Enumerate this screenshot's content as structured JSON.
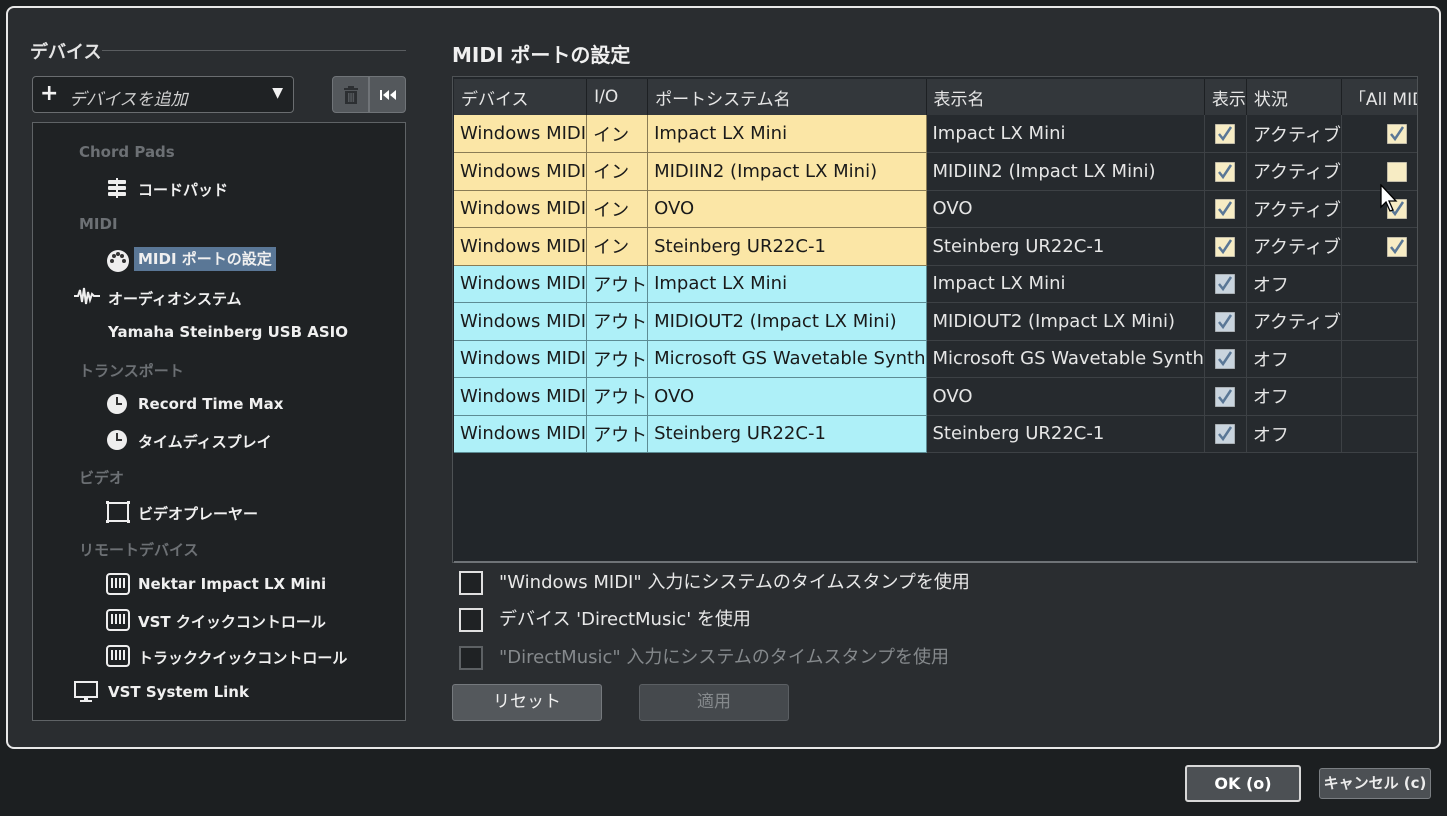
{
  "sidebar": {
    "heading": "デバイス",
    "add_device_label": "デバイスを追加",
    "tree": [
      {
        "type": "category",
        "label": "Chord Pads"
      },
      {
        "type": "device",
        "label": "コードパッド",
        "icon": "sliders-icon"
      },
      {
        "type": "category",
        "label": "MIDI"
      },
      {
        "type": "device",
        "label": "MIDI ポートの設定",
        "icon": "midi-din-icon",
        "selected": true
      },
      {
        "type": "device",
        "label": "オーディオシステム",
        "icon": "waveform-icon"
      },
      {
        "type": "device",
        "label": "Yamaha Steinberg USB ASIO",
        "icon": ""
      },
      {
        "type": "category",
        "label": "トランスポート"
      },
      {
        "type": "device",
        "label": "Record Time Max",
        "icon": "clock-icon"
      },
      {
        "type": "device",
        "label": "タイムディスプレイ",
        "icon": "clock-icon"
      },
      {
        "type": "category",
        "label": "ビデオ"
      },
      {
        "type": "device",
        "label": "ビデオプレーヤー",
        "icon": "film-icon"
      },
      {
        "type": "category",
        "label": "リモートデバイス"
      },
      {
        "type": "device",
        "label": "Nektar Impact LX Mini",
        "icon": "keyboard-icon"
      },
      {
        "type": "device",
        "label": "VST クイックコントロール",
        "icon": "keyboard-icon"
      },
      {
        "type": "device",
        "label": "トラッククイックコントロール",
        "icon": "keyboard-icon"
      },
      {
        "type": "device",
        "label": "VST System Link",
        "icon": "monitor-icon"
      }
    ]
  },
  "main": {
    "title": "MIDI ポートの設定",
    "columns": [
      "デバイス",
      "I/O",
      "ポートシステム名",
      "表示名",
      "表示",
      "状況",
      "「All MIDI In"
    ],
    "rows": [
      {
        "dir": "in",
        "device": "Windows MIDI",
        "io": "イン",
        "port": "Impact LX Mini",
        "display": "Impact LX Mini",
        "show": true,
        "status": "アクティブ",
        "all_midi": true
      },
      {
        "dir": "in",
        "device": "Windows MIDI",
        "io": "イン",
        "port": "MIDIIN2 (Impact LX Mini)",
        "display": "MIDIIN2 (Impact LX Mini)",
        "show": true,
        "status": "アクティブ",
        "all_midi": false
      },
      {
        "dir": "in",
        "device": "Windows MIDI",
        "io": "イン",
        "port": "OVO",
        "display": "OVO",
        "show": true,
        "status": "アクティブ",
        "all_midi": true
      },
      {
        "dir": "in",
        "device": "Windows MIDI",
        "io": "イン",
        "port": "Steinberg UR22C-1",
        "display": "Steinberg UR22C-1",
        "show": true,
        "status": "アクティブ",
        "all_midi": true
      },
      {
        "dir": "out",
        "device": "Windows MIDI",
        "io": "アウト",
        "port": "Impact LX Mini",
        "display": "Impact LX Mini",
        "show": true,
        "status": "オフ",
        "all_midi": null
      },
      {
        "dir": "out",
        "device": "Windows MIDI",
        "io": "アウト",
        "port": "MIDIOUT2 (Impact LX Mini)",
        "display": "MIDIOUT2 (Impact LX Mini)",
        "show": true,
        "status": "アクティブ",
        "all_midi": null
      },
      {
        "dir": "out",
        "device": "Windows MIDI",
        "io": "アウト",
        "port": "Microsoft GS Wavetable Synth",
        "display": "Microsoft GS Wavetable Synth",
        "show": true,
        "status": "オフ",
        "all_midi": null
      },
      {
        "dir": "out",
        "device": "Windows MIDI",
        "io": "アウト",
        "port": "OVO",
        "display": "OVO",
        "show": true,
        "status": "オフ",
        "all_midi": null
      },
      {
        "dir": "out",
        "device": "Windows MIDI",
        "io": "アウト",
        "port": "Steinberg UR22C-1",
        "display": "Steinberg UR22C-1",
        "show": true,
        "status": "オフ",
        "all_midi": null
      }
    ],
    "options": [
      {
        "label": "\"Windows MIDI\" 入力にシステムのタイムスタンプを使用",
        "checked": false,
        "disabled": false
      },
      {
        "label": "デバイス 'DirectMusic' を使用",
        "checked": false,
        "disabled": false
      },
      {
        "label": "\"DirectMusic\" 入力にシステムのタイムスタンプを使用",
        "checked": false,
        "disabled": true
      }
    ],
    "reset_label": "リセット",
    "apply_label": "適用"
  },
  "footer": {
    "ok_label": "OK (o)",
    "cancel_label": "キャンセル (c)"
  },
  "colors": {
    "input_row": "#fbe6a6",
    "output_row": "#aef0f8",
    "selection": "#5a7796",
    "check": "#5a7796"
  }
}
